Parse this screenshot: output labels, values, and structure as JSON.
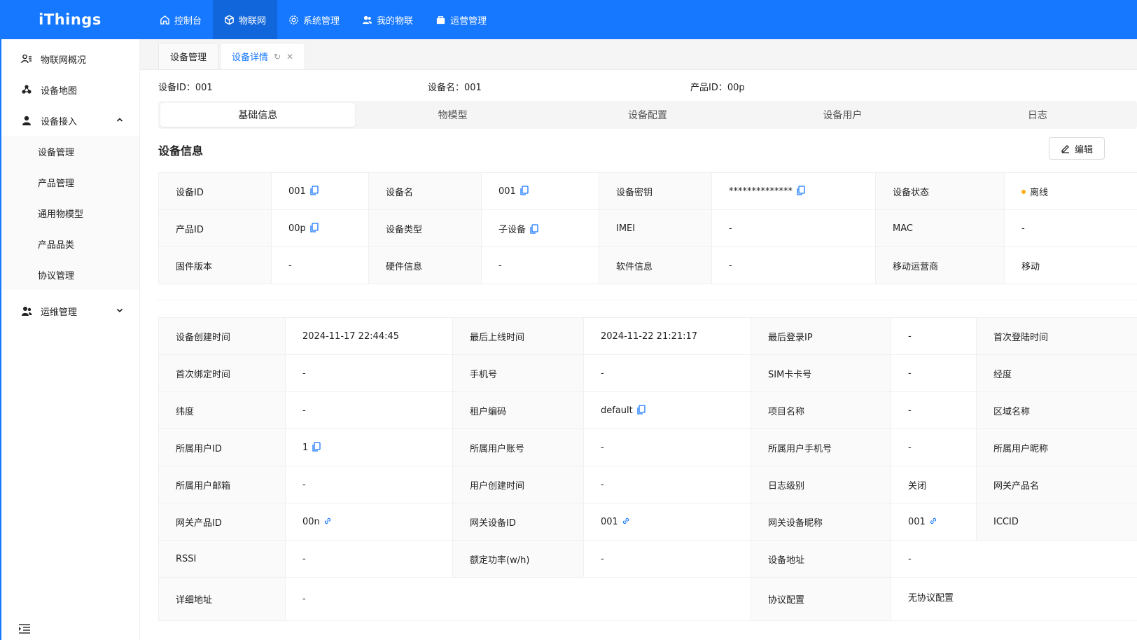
{
  "app": {
    "logo": "iThings"
  },
  "topnav": [
    {
      "label": "控制台",
      "icon": "home-icon"
    },
    {
      "label": "物联网",
      "icon": "cube-icon"
    },
    {
      "label": "系统管理",
      "icon": "gear-icon"
    },
    {
      "label": "我的物联",
      "icon": "users-icon"
    },
    {
      "label": "运营管理",
      "icon": "bag-icon"
    }
  ],
  "sidebar": {
    "items": [
      {
        "label": "物联网概况",
        "icon": "user-list-icon"
      },
      {
        "label": "设备地图",
        "icon": "cluster-icon"
      },
      {
        "label": "设备接入",
        "icon": "user-icon"
      },
      {
        "label": "运维管理",
        "icon": "team-icon"
      }
    ],
    "sub": [
      "设备管理",
      "产品管理",
      "通用物模型",
      "产品品类",
      "协议管理"
    ]
  },
  "tabs": [
    "设备管理",
    "设备详情"
  ],
  "header": {
    "device_id": "设备ID：001",
    "device_name": "设备名：001",
    "product_id": "产品ID：00p"
  },
  "segtabs": [
    "基础信息",
    "物模型",
    "设备配置",
    "设备用户",
    "日志"
  ],
  "section": {
    "title": "设备信息",
    "edit_label": "编辑"
  },
  "info1": [
    [
      "设备ID",
      "001",
      "设备名",
      "001",
      "设备密钥",
      "**************",
      "设备状态",
      "离线"
    ],
    [
      "产品ID",
      "00p",
      "设备类型",
      "子设备",
      "IMEI",
      "-",
      "MAC",
      "-"
    ],
    [
      "固件版本",
      "-",
      "硬件信息",
      "-",
      "软件信息",
      "-",
      "移动运营商",
      "移动"
    ]
  ],
  "info2": [
    [
      "设备创建时间",
      "2024-11-17 22:44:45",
      "最后上线时间",
      "2024-11-22 21:21:17",
      "最后登录IP",
      "-",
      "首次登陆时间"
    ],
    [
      "首次绑定时间",
      "-",
      "手机号",
      "-",
      "SIM卡卡号",
      "-",
      "经度"
    ],
    [
      "纬度",
      "-",
      "租户编码",
      "default",
      "项目名称",
      "-",
      "区域名称"
    ],
    [
      "所属用户ID",
      "1",
      "所属用户账号",
      "-",
      "所属用户手机号",
      "-",
      "所属用户昵称"
    ],
    [
      "所属用户邮箱",
      "-",
      "用户创建时间",
      "-",
      "日志级别",
      "关闭",
      "网关产品名"
    ],
    [
      "网关产品ID",
      "00n",
      "网关设备ID",
      "001",
      "网关设备昵称",
      "001",
      "ICCID"
    ],
    [
      "RSSI",
      "-",
      "额定功率(w/h)",
      "-",
      "设备地址",
      "-"
    ],
    [
      "详细地址",
      "-",
      "协议配置",
      "无协议配置"
    ]
  ],
  "colors": {
    "primary": "#1677ff",
    "offline_dot": "#faad14"
  }
}
